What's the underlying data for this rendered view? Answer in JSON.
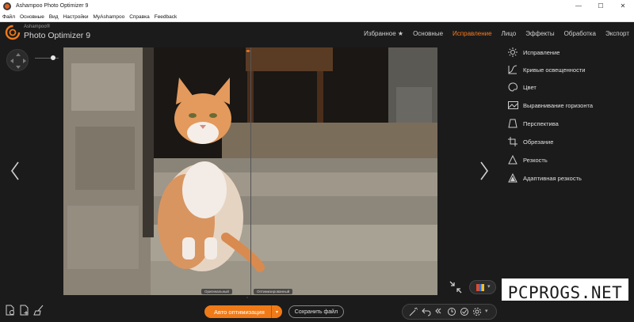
{
  "window": {
    "title": "Ashampoo Photo Optimizer 9",
    "controls": [
      "—",
      "☐",
      "✕"
    ]
  },
  "menu": [
    "Файл",
    "Основные",
    "Вид",
    "Настройки",
    "MyAshampoo",
    "Справка",
    "Feedback"
  ],
  "brand": {
    "small": "Ashampoo®",
    "big": "Photo Optimizer 9"
  },
  "tabs": [
    {
      "label": "Избранное ★",
      "active": false
    },
    {
      "label": "Основные",
      "active": false
    },
    {
      "label": "Исправление",
      "active": true
    },
    {
      "label": "Лицо",
      "active": false
    },
    {
      "label": "Эффекты",
      "active": false
    },
    {
      "label": "Обработка",
      "active": false
    },
    {
      "label": "Экспорт",
      "active": false
    }
  ],
  "right_panel": {
    "items": [
      {
        "label": "Исправление",
        "icon": "sun-icon"
      },
      {
        "label": "Кривые освещенности",
        "icon": "curves-icon"
      },
      {
        "label": "Цвет",
        "icon": "palette-icon"
      },
      {
        "label": "Выравнивание горизонта",
        "icon": "horizon-icon"
      },
      {
        "label": "Перспектива",
        "icon": "perspective-icon"
      },
      {
        "label": "Обрезание",
        "icon": "crop-icon"
      },
      {
        "label": "Резкость",
        "icon": "sharpness-icon"
      },
      {
        "label": "Адаптивная резкость",
        "icon": "adaptive-sharpness-icon"
      }
    ]
  },
  "compare": {
    "left_label": "Оригинальный",
    "right_label": "Оптимизированный"
  },
  "bottom": {
    "auto_label": "Авто оптимизация",
    "save_label": "Сохранить файл"
  },
  "watermark": "PCPROGS.NET",
  "colors": {
    "accent": "#f07a17",
    "background": "#1b1b1b"
  }
}
